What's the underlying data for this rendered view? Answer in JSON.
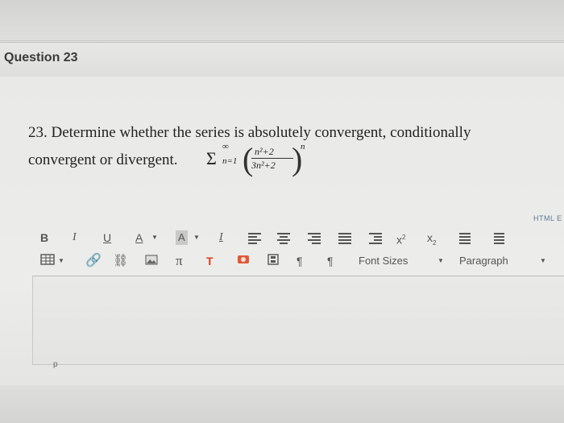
{
  "question": {
    "header": "Question 23",
    "line1": "23. Determine whether the series is absolutely convergent, conditionally",
    "line2": "convergent or divergent.",
    "math": {
      "sigma": "Σ",
      "upper": "∞",
      "lower": "n=1",
      "numerator": "n²+2",
      "denominator": "3n²+2",
      "exponent": "n"
    }
  },
  "editor": {
    "html_link": "HTML E",
    "toolbar1": {
      "bold": "B",
      "italic": "I",
      "underline": "U",
      "font_color": "A",
      "highlight": "A",
      "clear_format": "I",
      "superscript": "x",
      "subscript": "x"
    },
    "toolbar2": {
      "math": "π",
      "text_t": "T",
      "font_sizes": "Font Sizes",
      "paragraph": "Paragraph"
    },
    "status_path": "p"
  }
}
